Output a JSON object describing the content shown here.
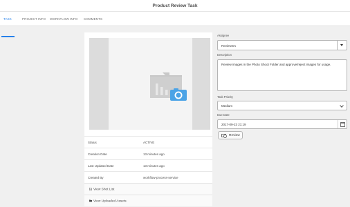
{
  "header": {
    "title": "Product Review Task"
  },
  "tabs": [
    {
      "label": "TASK",
      "active": true
    },
    {
      "label": "PROJECT INFO",
      "active": false
    },
    {
      "label": "WORKFLOW INFO",
      "active": false
    },
    {
      "label": "COMMENTS",
      "active": false
    }
  ],
  "card": {
    "thumbnail_icon": "folder-camera-icon",
    "meta": [
      {
        "label": "Status",
        "value": "ACTIVE"
      },
      {
        "label": "Creation Date",
        "value": "13 minutes ago"
      },
      {
        "label": "Last Updated Date",
        "value": "13 minutes ago"
      },
      {
        "label": "Created By",
        "value": "workflow-process-service"
      }
    ],
    "actions": [
      {
        "label": "View Shot List",
        "icon": "document-icon"
      },
      {
        "label": "View Uploaded Assets",
        "icon": "folder-icon"
      }
    ]
  },
  "form": {
    "assignee": {
      "label": "Assignee",
      "value": "Reviewers"
    },
    "description": {
      "label": "Description",
      "value": "Review images in the Photo Shoot Folder and approve/reject images for usage."
    },
    "priority": {
      "label": "Task Priority",
      "value": "Medium"
    },
    "due_date": {
      "label": "Due Date",
      "value": "2017-09-23 21:19"
    },
    "review_button": "Review"
  },
  "colors": {
    "accent": "#2680eb",
    "camera": "#4ba3e6"
  }
}
